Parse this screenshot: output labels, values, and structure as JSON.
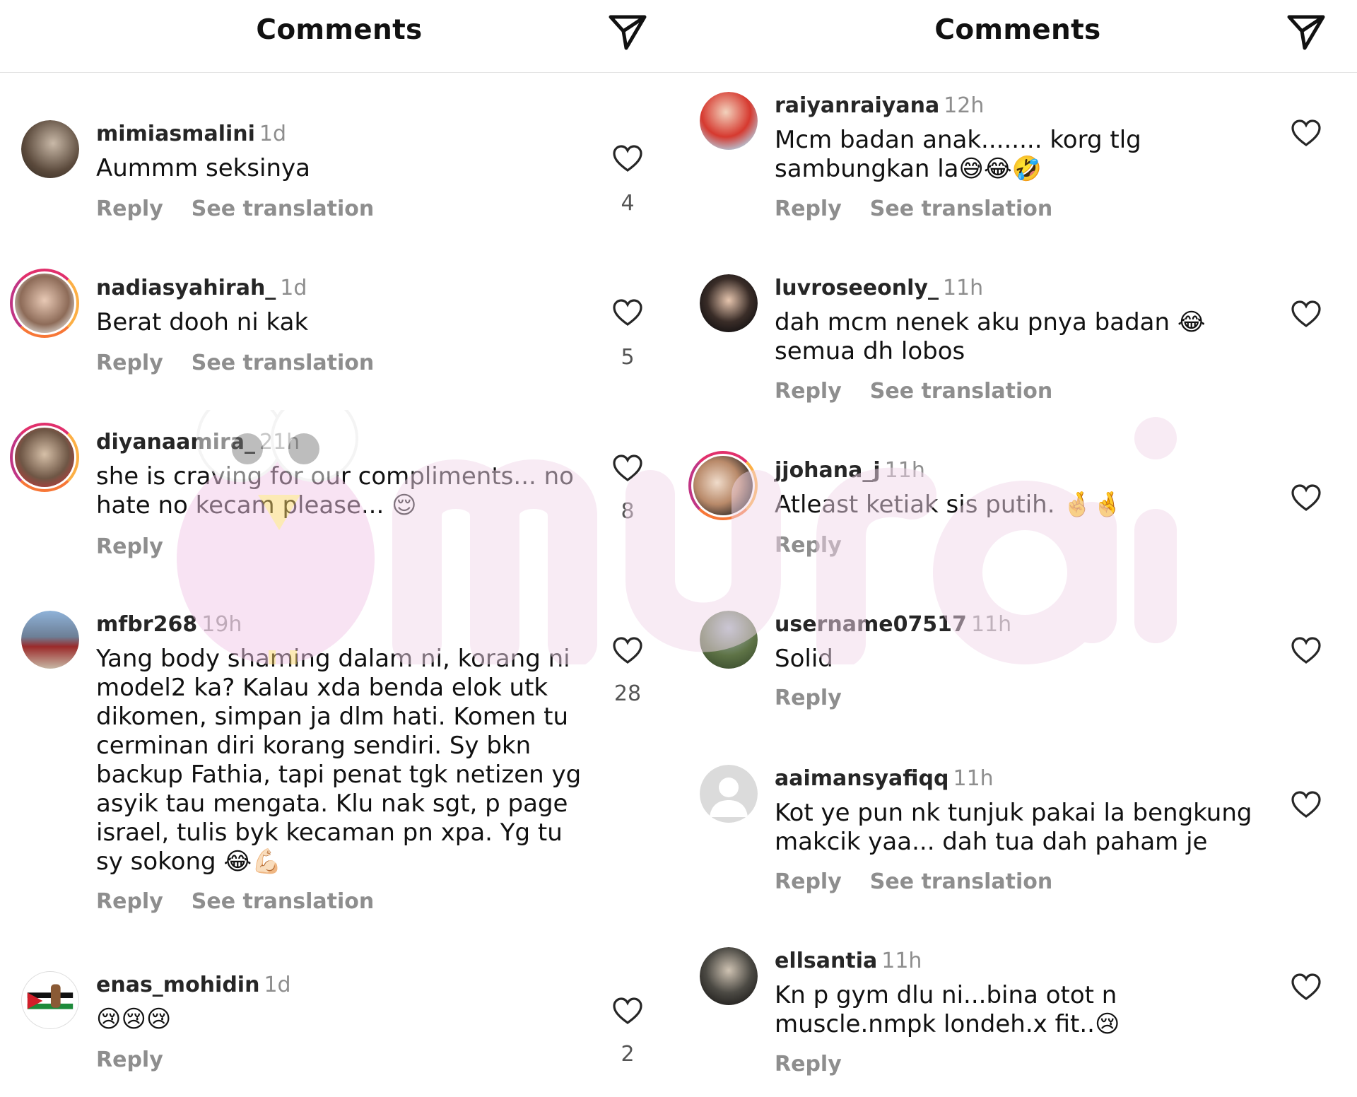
{
  "left": {
    "title": "Comments",
    "comments": [
      {
        "user": "mimiasmalini",
        "time": "1d",
        "text": "Aummm seksinya",
        "reply": "Reply",
        "translate": "See translation",
        "likes": "4"
      },
      {
        "user": "nadiasyahirah_",
        "time": "1d",
        "text": "Berat dooh ni kak",
        "reply": "Reply",
        "translate": "See translation",
        "likes": "5"
      },
      {
        "user": "diyanaamira_",
        "time": "21h",
        "text": "she is craving for our compliments... no hate no kecam please... 😌",
        "reply": "Reply",
        "likes": "8"
      },
      {
        "user": "mfbr268",
        "time": "19h",
        "text": "Yang body shaming dalam ni, korang ni model2 ka? Kalau xda benda elok utk dikomen, simpan ja dlm hati. Komen tu cerminan diri korang sendiri. Sy bkn backup Fathia, tapi penat tgk netizen yg asyik tau mengata. Klu nak sgt, p page israel, tulis byk kecaman pn xpa. Yg tu sy sokong 😂💪🏻",
        "reply": "Reply",
        "translate": "See translation",
        "likes": "28"
      },
      {
        "user": "enas_mohidin",
        "time": "1d",
        "text": "😢😢😢",
        "reply": "Reply",
        "likes": "2"
      }
    ]
  },
  "right": {
    "title": "Comments",
    "comments": [
      {
        "user": "raiyanraiyana",
        "time": "12h",
        "text": "Mcm badan anak........ korg tlg sambungkan la😅😂🤣",
        "reply": "Reply",
        "translate": "See translation"
      },
      {
        "user": "luvroseeonly_",
        "time": "11h",
        "text": "dah mcm nenek aku pnya badan 😂 semua dh lobos",
        "reply": "Reply",
        "translate": "See translation"
      },
      {
        "user": "jjohana_j",
        "time": "11h",
        "text": "Atleast ketiak sis putih. 🤞🤞",
        "reply": "Reply"
      },
      {
        "user": "username07517",
        "time": "11h",
        "text": "Solid",
        "reply": "Reply"
      },
      {
        "user": "aaimansyafiqq",
        "time": "11h",
        "text": "Kot ye pun nk tunjuk pakai la bengkung makcik yaa... dah tua dah paham je",
        "reply": "Reply",
        "translate": "See translation"
      },
      {
        "user": "ellsantia",
        "time": "11h",
        "text": "Kn p gym dlu ni...bina otot n muscle.nmpk londeh.x fit..😢",
        "reply": "Reply"
      }
    ]
  },
  "icons": {
    "send": "paper-plane-icon",
    "like": "heart-outline-icon"
  },
  "colors": {
    "text": "#111111",
    "muted": "#8e8e8e",
    "story_ring": "#e1306c",
    "watermark_pink": "#f1c6e6"
  }
}
